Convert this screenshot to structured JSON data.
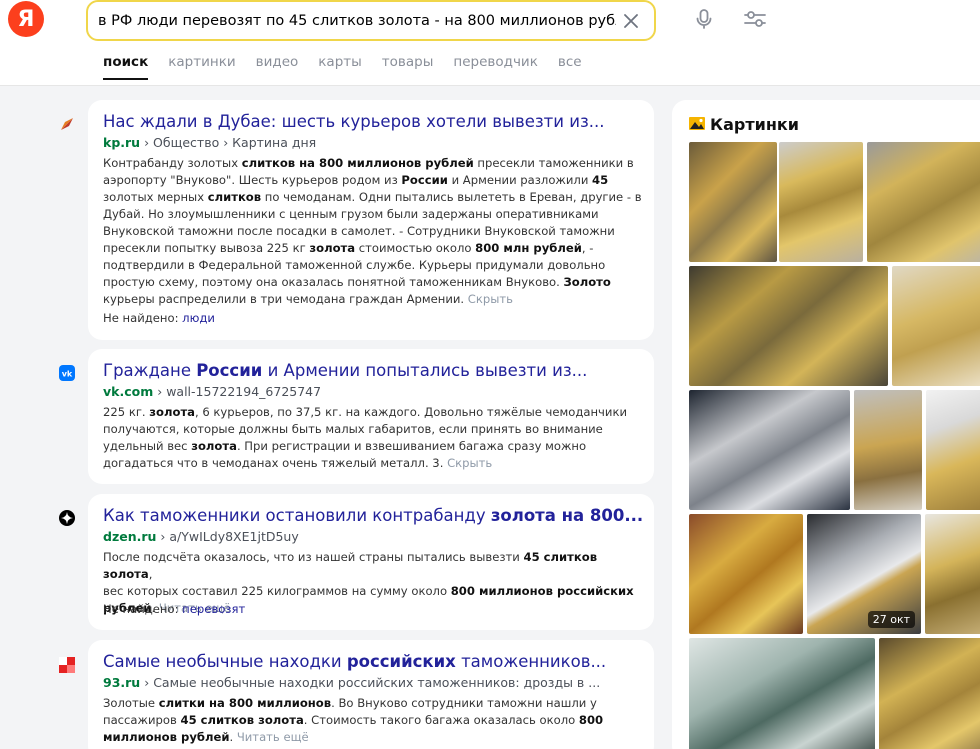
{
  "header": {
    "logo_letter": "Я",
    "query": "в РФ люди перевозят по 45 слитков золота - на 800 миллионов рублей"
  },
  "tabs": [
    {
      "label": "поиск",
      "active": true
    },
    {
      "label": "картинки"
    },
    {
      "label": "видео"
    },
    {
      "label": "карты"
    },
    {
      "label": "товары"
    },
    {
      "label": "переводчик"
    },
    {
      "label": "все"
    }
  ],
  "results": [
    {
      "title_parts": [
        [
          "Нас ждали в Дубае: шесть курьеров хотели вывезти из...",
          false
        ]
      ],
      "domain": "kp.ru",
      "path": "Общество › Картина дня",
      "snippet_lines": [
        [
          [
            "Контрабанду золотых ",
            false
          ],
          [
            "слитков на 800 миллионов рублей",
            true
          ],
          [
            " пресекли таможенники в",
            false
          ]
        ],
        [
          [
            "аэропорту \"Внуково\". Шесть курьеров родом из ",
            false
          ],
          [
            "России",
            true
          ],
          [
            " и Армении разложили ",
            false
          ],
          [
            "45",
            true
          ]
        ],
        [
          [
            "золотых мерных ",
            false
          ],
          [
            "слитков",
            true
          ],
          [
            " по чемоданам. Одни пытались вылететь в Ереван, другие - в",
            false
          ]
        ],
        [
          [
            "Дубай. Но злоумышленники с ценным грузом были задержаны оперативниками",
            false
          ]
        ],
        [
          [
            "Внуковской таможни после посадки в самолет. - Сотрудники Внуковской таможни",
            false
          ]
        ],
        [
          [
            "пресекли попытку вывоза 225 кг ",
            false
          ],
          [
            "золота",
            true
          ],
          [
            " стоимостью около ",
            false
          ],
          [
            "800 млн рублей",
            true
          ],
          [
            ", -",
            false
          ]
        ],
        [
          [
            "подтвердили в Федеральной таможенной службе. Курьеры придумали довольно",
            false
          ]
        ],
        [
          [
            "простую схему, поэтому она оказалась понятной таможенникам Внуково. ",
            false
          ],
          [
            "Золото",
            true
          ]
        ],
        [
          [
            "курьеры распределили в три чемодана граждан Армении. ",
            false
          ]
        ]
      ],
      "more": "Скрыть",
      "not_found_label": "Не найдено: ",
      "not_found_word": "люди"
    },
    {
      "title_parts": [
        [
          "Граждане ",
          false
        ],
        [
          "России",
          true
        ],
        [
          " и Армении попытались вывезти из...",
          false
        ]
      ],
      "domain": "vk.com",
      "path": "wall-15722194_6725747",
      "snippet_lines": [
        [
          [
            "225 кг. ",
            false
          ],
          [
            "золота",
            true
          ],
          [
            ", 6 курьеров, по 37,5 кг. на каждого. Довольно тяжёлые чемоданчики",
            false
          ]
        ],
        [
          [
            "получаются, которые должны быть малых габаритов, если принять во внимание",
            false
          ]
        ],
        [
          [
            "удельный вес ",
            false
          ],
          [
            "золота",
            true
          ],
          [
            ". При регистрации и взвешиванием багажа сразу можно",
            false
          ]
        ],
        [
          [
            "догадаться что в чемоданах очень тяжелый металл. 3. ",
            false
          ]
        ]
      ],
      "more": "Скрыть"
    },
    {
      "title_parts": [
        [
          "Как таможенники остановили контрабанду ",
          false
        ],
        [
          "золота на 800...",
          true
        ]
      ],
      "domain": "dzen.ru",
      "path": "a/YwILdy8XE1jtD5uy",
      "snippet_lines": [
        [
          [
            "После подсчёта оказалось, что из нашей страны пытались вывезти ",
            false
          ],
          [
            "45 слитков золота",
            true
          ],
          [
            ",",
            false
          ]
        ],
        [
          [
            "вес которых составил 225 килограммов на сумму около ",
            false
          ],
          [
            "800 миллионов российских",
            true
          ]
        ],
        [
          [
            "рублей",
            true
          ],
          [
            ". ",
            false
          ]
        ]
      ],
      "more": "Читать ещё",
      "not_found_label": "Не найдено: ",
      "not_found_word": "перевозят"
    },
    {
      "title_parts": [
        [
          "Самые необычные находки ",
          false
        ],
        [
          "российских",
          true
        ],
        [
          " таможенников...",
          false
        ]
      ],
      "domain": "93.ru",
      "path": "Самые необычные находки российских таможенников: дрозды в ...",
      "snippet_lines": [
        [
          [
            "Золотые ",
            false
          ],
          [
            "слитки на 800 миллионов",
            true
          ],
          [
            ". Во Внуково сотрудники таможни нашли у",
            false
          ]
        ],
        [
          [
            "пассажиров ",
            false
          ],
          [
            "45 слитков золота",
            true
          ],
          [
            ". Стоимость такого багажа оказалась около ",
            false
          ],
          [
            "800",
            true
          ]
        ],
        [
          [
            "миллионов рублей",
            true
          ],
          [
            ". ",
            false
          ]
        ]
      ],
      "more": "Читать ещё"
    }
  ],
  "images_panel": {
    "title": "Картинки",
    "badge": "27 окт"
  },
  "colors": {
    "link": "#22229a",
    "domain": "#007a3d",
    "search_border": "#f0d64a",
    "logo": "#fc3f1d"
  }
}
